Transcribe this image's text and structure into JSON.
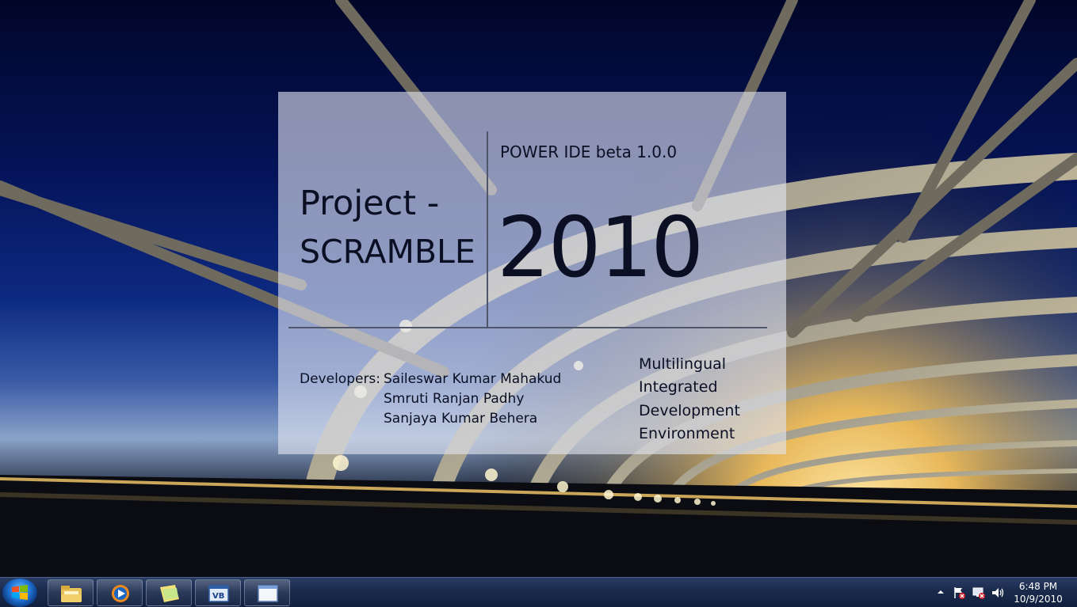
{
  "splash": {
    "product_version": "POWER IDE beta 1.0.0",
    "project_title_line1": "Project -",
    "project_title_line2": "SCRAMBLE",
    "year": "2010",
    "developers_label": "Developers:",
    "developers": [
      "Saileswar Kumar Mahakud",
      "Smruti Ranjan Padhy",
      "Sanjaya Kumar Behera"
    ],
    "tagline": [
      "Multilingual",
      "Integrated",
      "Development",
      "Environment"
    ]
  },
  "taskbar": {
    "start_icon": "windows-start-orb",
    "pinned": [
      {
        "icon": "windows-explorer-icon"
      },
      {
        "icon": "media-player-icon"
      },
      {
        "icon": "sticky-notes-icon"
      },
      {
        "icon": "visual-basic-icon"
      },
      {
        "icon": "window-icon"
      }
    ],
    "tray_icons": [
      "show-hidden-icons",
      "action-center-icon",
      "network-icon",
      "volume-icon"
    ],
    "clock": {
      "time": "6:48 PM",
      "date": "10/9/2010"
    }
  },
  "colors": {
    "taskbar": "#1a2a4c",
    "splash_text": "#0b0f24",
    "splash_lines": "#4f5669"
  }
}
